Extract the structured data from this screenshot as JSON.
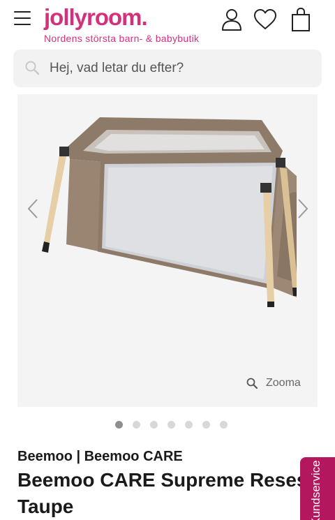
{
  "header": {
    "logo": "jollyroom.",
    "tagline": "Nordens största barn- & babybutik",
    "icons": [
      "menu-icon",
      "account-icon",
      "heart-icon",
      "bag-icon"
    ]
  },
  "search": {
    "placeholder": "Hej, vad letar du efter?",
    "value": ""
  },
  "gallery": {
    "zoom_label": "Zooma",
    "image_count": 7,
    "active_index": 0
  },
  "product": {
    "brand": "Beemoo | Beemoo CARE",
    "title": "Beemoo CARE Supreme Resesäng\nTaupe"
  },
  "service_tab": {
    "label": "Kundservice"
  },
  "colors": {
    "brand_pink": "#d4317c",
    "service_tab": "#b3185f"
  }
}
